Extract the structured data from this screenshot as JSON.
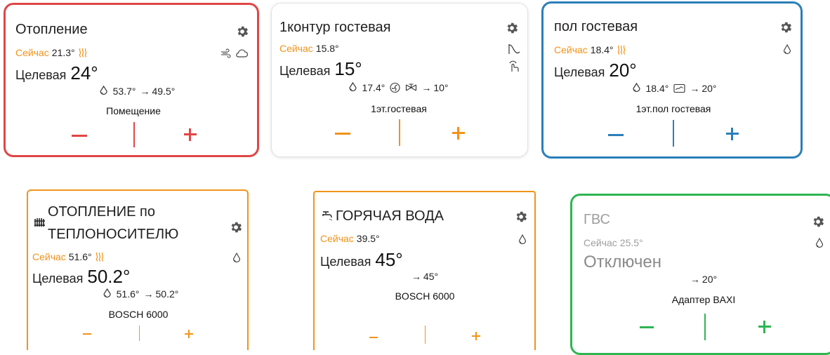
{
  "colors": {
    "red": "#e04545",
    "orange": "#f29318",
    "blue": "#2a7fb8",
    "green": "#2fb552",
    "now": "#f29318",
    "grey": "#9e9e9e"
  },
  "cards": [
    {
      "title": "Отопление",
      "now_label": "Сейчас",
      "now_value": "21.3°",
      "target_label": "Целевая",
      "target_value": "24°",
      "flow": "53.7°",
      "arrow": "→",
      "return": "49.5°",
      "device": "Помещение",
      "side_icons": [
        "wind-icon",
        "cloud-icon"
      ]
    },
    {
      "title": "1контур гостевая",
      "now_label": "Сейчас",
      "now_value": "15.8°",
      "target_label": "Целевая",
      "target_value": "15°",
      "flow": "17.4°",
      "arrow": "→",
      "return": "10°",
      "device": "1эт.гостевая",
      "side_icons": [
        "curve-icon",
        "hand-icon"
      ]
    },
    {
      "title": "пол гостевая",
      "now_label": "Сейчас",
      "now_value": "18.4°",
      "target_label": "Целевая",
      "target_value": "20°",
      "flow": "18.4°",
      "arrow": "→",
      "return": "20°",
      "device": "1эт.пол гостевая",
      "side_icons": [
        "drop-icon"
      ]
    },
    {
      "title_line1": "ОТОПЛЕНИЕ по",
      "title_line2": "ТЕПЛОНОСИТЕЛЮ",
      "now_label": "Сейчас",
      "now_value": "51.6°",
      "target_label": "Целевая",
      "target_value": "50.2°",
      "flow": "51.6°",
      "arrow": "→",
      "return": "50.2°",
      "device": "BOSCH 6000",
      "side_icons": [
        "drop-icon"
      ]
    },
    {
      "title": "ГОРЯЧАЯ ВОДА",
      "now_label": "Сейчас",
      "now_value": "39.5°",
      "target_label": "Целевая",
      "target_value": "45°",
      "arrow": "→",
      "return": "45°",
      "device": "BOSCH 6000",
      "side_icons": [
        "drop-icon"
      ]
    },
    {
      "title": "ГВС",
      "now_label": "Сейчас",
      "now_value": "25.5°",
      "status": "Отключен",
      "arrow": "→",
      "return": "20°",
      "device": "Адаптер BAXI",
      "side_icons": [
        "drop-icon"
      ]
    }
  ]
}
